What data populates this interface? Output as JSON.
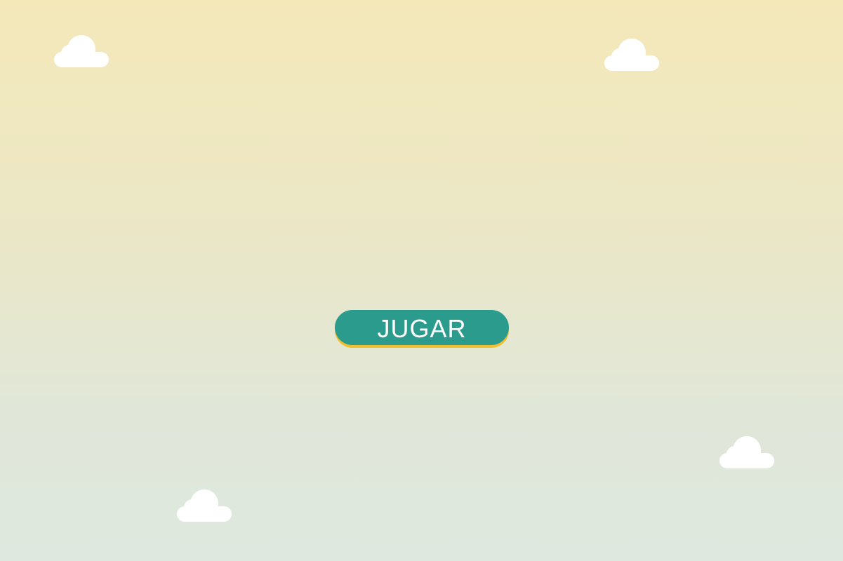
{
  "menu": {
    "play_label": "JUGAR"
  },
  "colors": {
    "sky_top": "#f4e8b9",
    "sky_bottom": "#dee8de",
    "button_fill": "#2a9b8d",
    "button_shadow": "#f0c030",
    "cloud": "#ffffff"
  }
}
